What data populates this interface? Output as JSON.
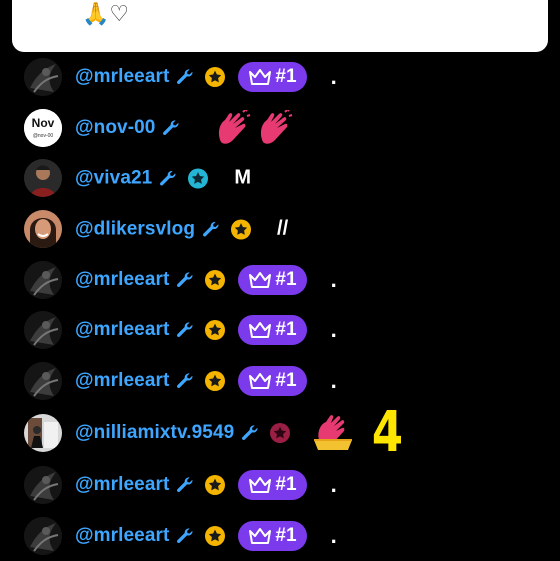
{
  "pinned": {
    "emoji": "🙏♡"
  },
  "colors": {
    "username": "#3ea6ff",
    "wrench": "#3ea6ff",
    "badge_gold": "#f5b400",
    "badge_teal": "#23b5d3",
    "badge_maroon": "#9b1f45",
    "rank_badge": "#7c3aed",
    "annotation_yellow": "#ffe600"
  },
  "messages": [
    {
      "username": "@mrleeart",
      "avatar": "dark-sketch-avatar",
      "badge": "gold-star",
      "rank": "#1",
      "text": "."
    },
    {
      "username": "@nov-00",
      "avatar": "nov-logo-avatar",
      "avatar_text": "Nov",
      "avatar_subtext": "@nov-00",
      "badge": "none",
      "text": "",
      "emoji": "clap-pink-x2"
    },
    {
      "username": "@viva21",
      "avatar": "portrait-avatar",
      "badge": "teal-star",
      "text": "M"
    },
    {
      "username": "@dlikersvlog",
      "avatar": "smiling-portrait-avatar",
      "badge": "gold-star",
      "text": "//"
    },
    {
      "username": "@mrleeart",
      "avatar": "dark-sketch-avatar",
      "badge": "gold-star",
      "rank": "#1",
      "text": "."
    },
    {
      "username": "@mrleeart",
      "avatar": "dark-sketch-avatar",
      "badge": "gold-star",
      "rank": "#1",
      "text": "."
    },
    {
      "username": "@mrleeart",
      "avatar": "dark-sketch-avatar",
      "badge": "gold-star",
      "rank": "#1",
      "text": "."
    },
    {
      "username": "@nilliamixtv.9549",
      "avatar": "room-photo-avatar",
      "badge": "maroon-star",
      "text": "",
      "emoji": "clap-bucket",
      "number": "4"
    },
    {
      "username": "@mrleeart",
      "avatar": "dark-sketch-avatar",
      "badge": "gold-star",
      "rank": "#1",
      "text": "."
    },
    {
      "username": "@mrleeart",
      "avatar": "dark-sketch-avatar",
      "badge": "gold-star",
      "rank": "#1",
      "text": "."
    }
  ]
}
